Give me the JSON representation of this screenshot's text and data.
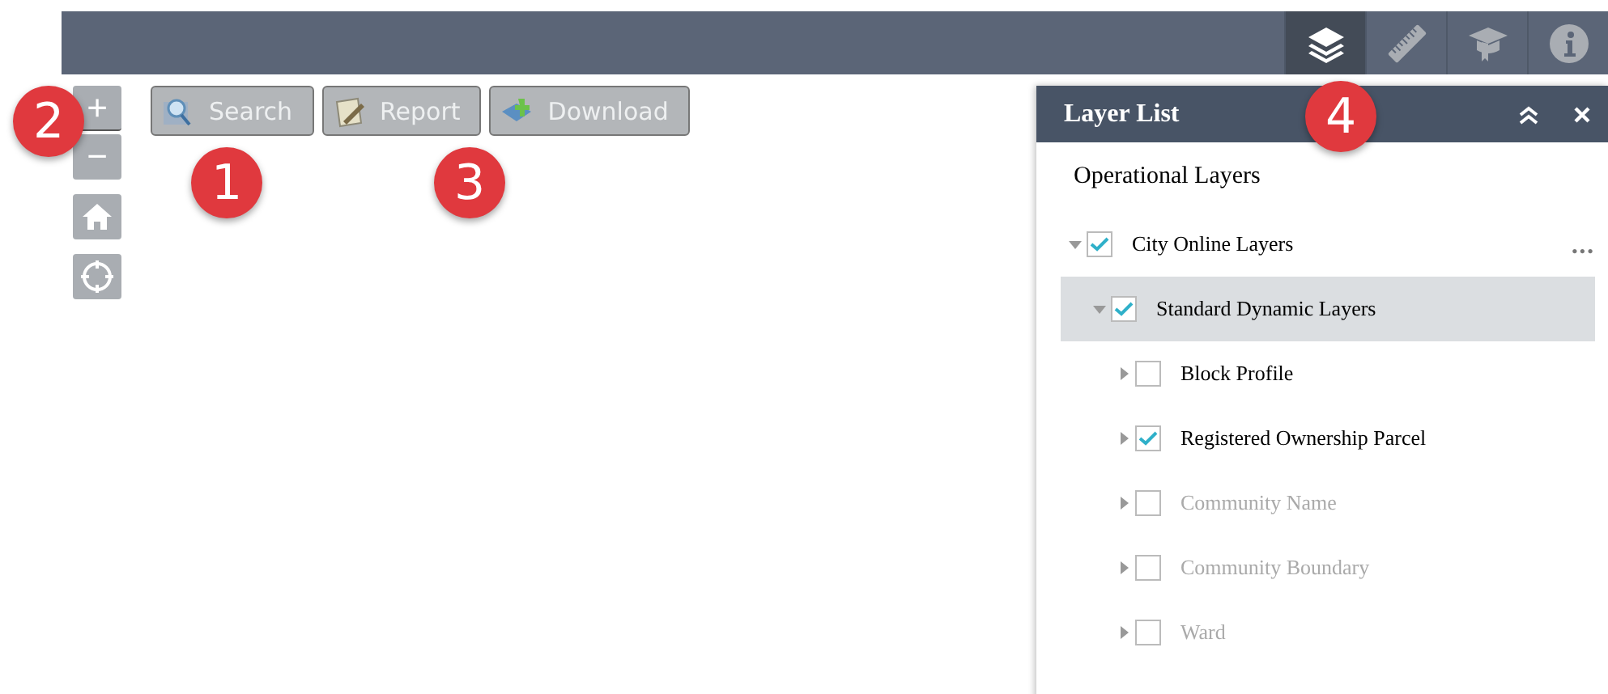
{
  "toolbar": {
    "tools": [
      {
        "kind": "layers",
        "selected": true
      },
      {
        "kind": "ruler",
        "selected": false
      },
      {
        "kind": "cap",
        "selected": false
      },
      {
        "kind": "info",
        "selected": false
      }
    ]
  },
  "map_controls": [
    {
      "kind": "zoom-in",
      "label": "+"
    },
    {
      "kind": "zoom-out",
      "label": "−"
    },
    {
      "kind": "home"
    },
    {
      "kind": "locate"
    }
  ],
  "widget_buttons": [
    {
      "kind": "search",
      "label": "Search"
    },
    {
      "kind": "report",
      "label": "Report"
    },
    {
      "kind": "download",
      "label": "Download"
    }
  ],
  "callouts": [
    "1",
    "2",
    "3",
    "4"
  ],
  "panel": {
    "title": "Layer List",
    "section": "Operational Layers",
    "layers": [
      {
        "label": "City Online Layers",
        "checked": true,
        "expanded": true,
        "disabled": false,
        "selected": false,
        "menu": "•••",
        "children": [
          {
            "label": "Standard Dynamic Layers",
            "checked": true,
            "expanded": true,
            "disabled": false,
            "selected": true,
            "children": [
              {
                "label": "Block Profile",
                "checked": false,
                "expanded": false,
                "disabled": false,
                "selected": false
              },
              {
                "label": "Registered Ownership Parcel",
                "checked": true,
                "expanded": false,
                "disabled": false,
                "selected": false
              },
              {
                "label": "Community Name",
                "checked": false,
                "expanded": false,
                "disabled": true,
                "selected": false
              },
              {
                "label": "Community Boundary",
                "checked": false,
                "expanded": false,
                "disabled": true,
                "selected": false
              },
              {
                "label": "Ward",
                "checked": false,
                "expanded": false,
                "disabled": true,
                "selected": false
              }
            ]
          }
        ]
      }
    ]
  }
}
